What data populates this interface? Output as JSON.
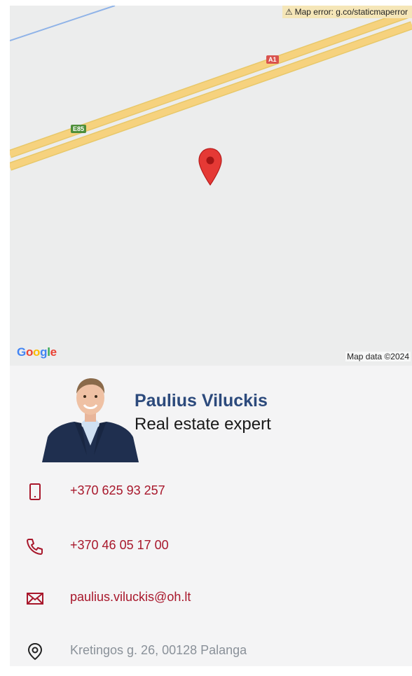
{
  "map": {
    "error_text": "Map error: g.co/staticmaperror",
    "road_shields": {
      "a1": "A1",
      "e85": "E85"
    },
    "google_logo": [
      "G",
      "o",
      "o",
      "g",
      "l",
      "e"
    ],
    "google_logo_colors": [
      "#4285F4",
      "#EA4335",
      "#FBBC05",
      "#4285F4",
      "#34A853",
      "#EA4335"
    ],
    "map_data": "Map data ©2024",
    "pin_color": "#e53935"
  },
  "agent": {
    "name": "Paulius Viluckis",
    "role": "Real estate expert"
  },
  "contacts": {
    "mobile": "+370 625 93 257",
    "phone": "+370 46 05 17 00",
    "email": "paulius.viluckis@oh.lt",
    "address": "Kretingos g. 26, 00128 Palanga",
    "icons": [
      "mobile-phone-icon",
      "phone-icon",
      "envelope-icon",
      "location-pin-icon"
    ],
    "accent_color": "#a8172b"
  }
}
